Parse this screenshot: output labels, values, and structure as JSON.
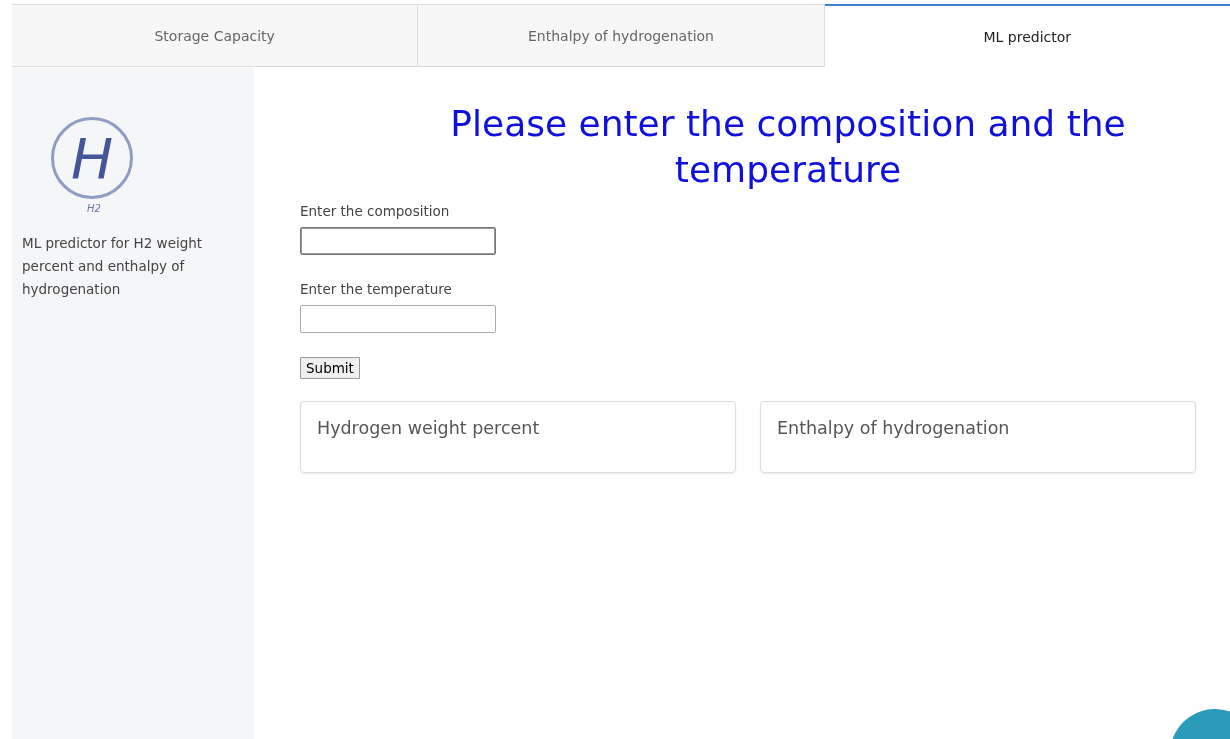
{
  "tabs": [
    {
      "label": "Storage Capacity",
      "selected": false
    },
    {
      "label": "Enthalpy of hydrogenation",
      "selected": false
    },
    {
      "label": "ML predictor",
      "selected": true
    }
  ],
  "sidebar": {
    "logo": {
      "letter": "H",
      "caption": "H2"
    },
    "description": "ML predictor for H2 weight percent and enthalpy of hydrogenation"
  },
  "main": {
    "heading": "Please enter the composition and the temperature",
    "fields": [
      {
        "label": "Enter the composition",
        "focused": true
      },
      {
        "label": "Enter the temperature",
        "focused": false
      }
    ],
    "submit": "Submit",
    "results": [
      {
        "title": "Hydrogen weight percent"
      },
      {
        "title": "Enthalpy of hydrogenation"
      }
    ]
  }
}
